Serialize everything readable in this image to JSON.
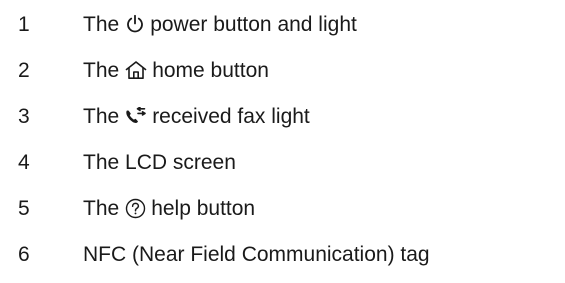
{
  "items": [
    {
      "number": "1",
      "prefix": "The",
      "icon": "power-icon",
      "suffix": "power button and light"
    },
    {
      "number": "2",
      "prefix": "The",
      "icon": "home-icon",
      "suffix": "home button"
    },
    {
      "number": "3",
      "prefix": "The",
      "icon": "received-fax-icon",
      "suffix": "received fax light"
    },
    {
      "number": "4",
      "text": "The LCD screen"
    },
    {
      "number": "5",
      "prefix": "The",
      "icon": "help-icon",
      "suffix": "help button"
    },
    {
      "number": "6",
      "text": "NFC (Near Field Communication) tag"
    }
  ]
}
